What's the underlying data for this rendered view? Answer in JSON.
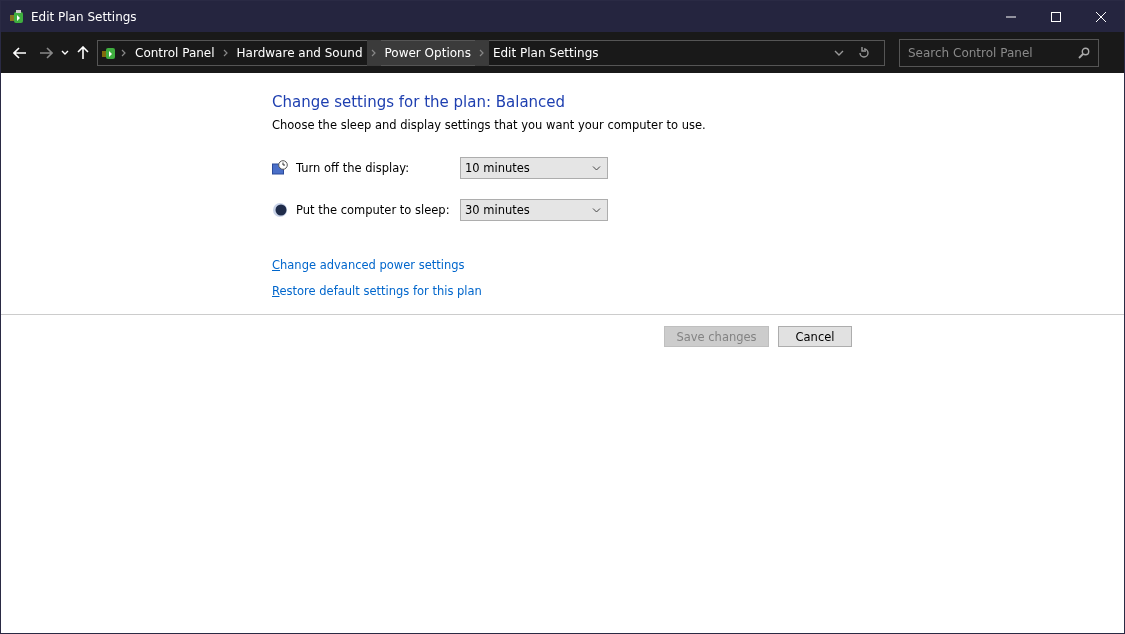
{
  "window": {
    "title": "Edit Plan Settings"
  },
  "breadcrumbs": [
    {
      "label": "Control Panel",
      "highlighted": false
    },
    {
      "label": "Hardware and Sound",
      "highlighted": false
    },
    {
      "label": "Power Options",
      "highlighted": true
    },
    {
      "label": "Edit Plan Settings",
      "highlighted": false
    }
  ],
  "search": {
    "placeholder": "Search Control Panel"
  },
  "heading": "Change settings for the plan: Balanced",
  "description": "Choose the sleep and display settings that you want your computer to use.",
  "settings": [
    {
      "kind": "display",
      "label": "Turn off the display:",
      "value": "10 minutes"
    },
    {
      "kind": "sleep",
      "label": "Put the computer to sleep:",
      "value": "30 minutes"
    }
  ],
  "links": [
    "Change advanced power settings",
    "Restore default settings for this plan"
  ],
  "buttons": [
    {
      "label": "Save changes",
      "disabled": true
    },
    {
      "label": "Cancel",
      "disabled": false
    }
  ]
}
